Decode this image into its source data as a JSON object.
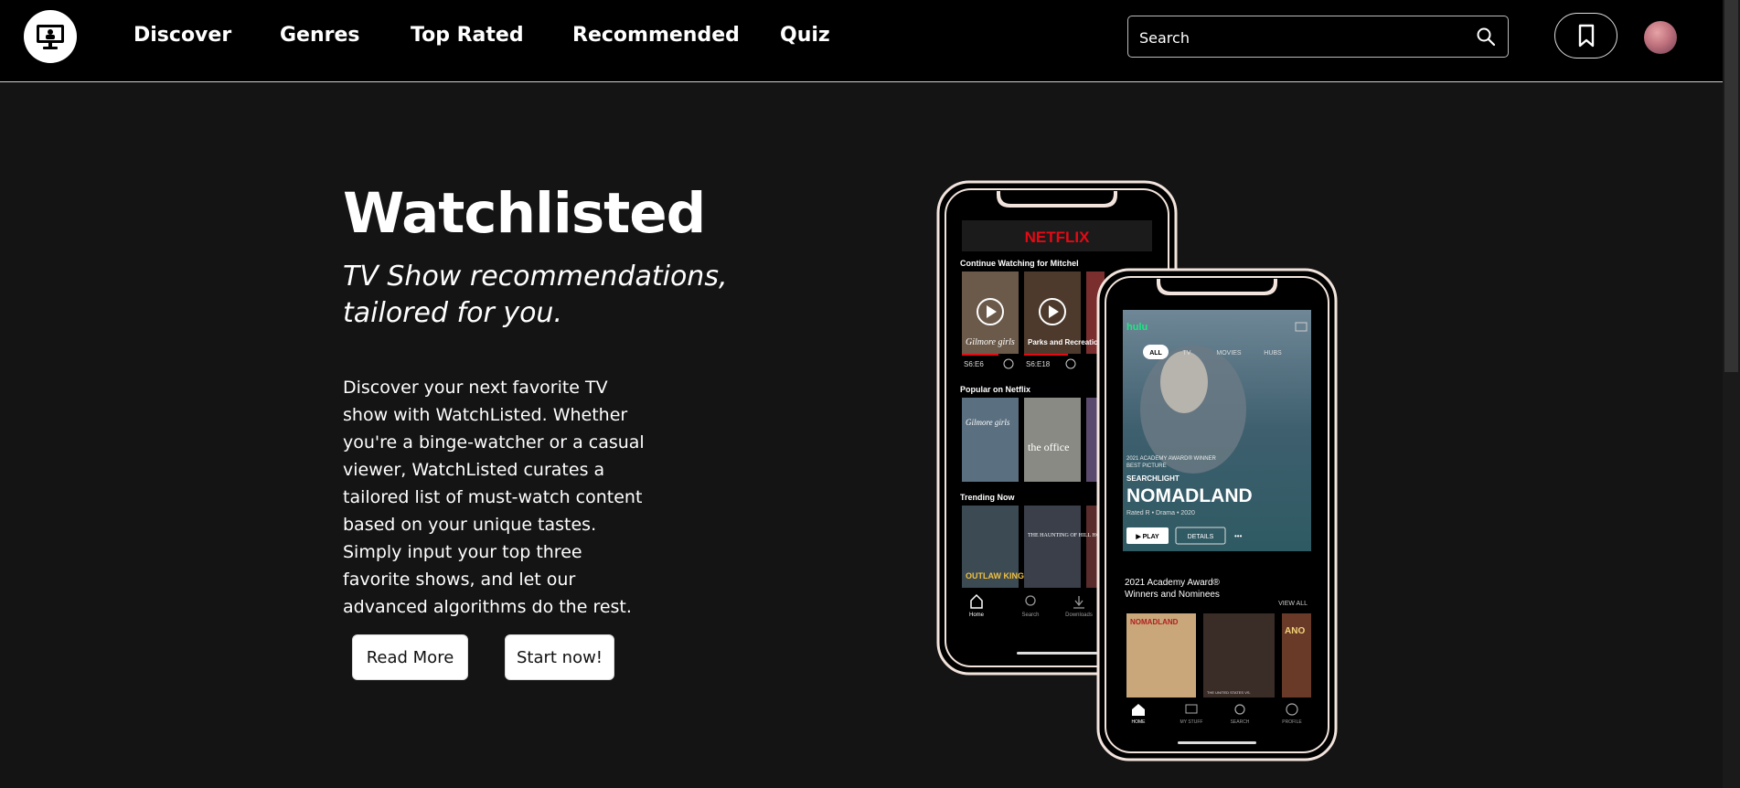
{
  "nav": {
    "links": [
      "Discover",
      "Genres",
      "Top Rated",
      "Recommended",
      "Quiz"
    ],
    "search_placeholder": "Search",
    "icons": {
      "logo": "tv-monitor-icon",
      "search": "search-icon",
      "bookmark": "bookmark-icon",
      "avatar": "user-avatar"
    }
  },
  "hero": {
    "title": "Watchlisted",
    "tagline": "TV Show recommendations, tailored for you.",
    "description": "Discover your next favorite TV show with WatchListed. Whether you're a binge-watcher or a casual viewer, WatchListed curates a tailored list of must-watch content based on your unique tastes. Simply input your top three favorite shows, and let our advanced algorithms do the rest.",
    "buttons": [
      "Read More",
      "Start now!"
    ]
  },
  "phone_netflix": {
    "brand": "NETFLIX",
    "continue_heading": "Continue Watching for Mitchel",
    "continue_items": [
      "Gilmore girls",
      "Parks and Recreation"
    ],
    "episodes": [
      "S6:E6",
      "S6:E18"
    ],
    "popular_heading": "Popular on Netflix",
    "popular_items": [
      "Gilmore girls",
      "the office"
    ],
    "trending_heading": "Trending Now",
    "trending_items": [
      "OUTLAW KING",
      "THE HAUNTING OF HILL HOUSE"
    ],
    "tabbar": [
      "Home",
      "Search",
      "Downloads"
    ]
  },
  "phone_hulu": {
    "brand": "hulu",
    "tabs": [
      "ALL",
      "TV",
      "MOVIES",
      "HUBS"
    ],
    "award_line1": "2021 ACADEMY AWARD® WINNER",
    "award_line2": "BEST PICTURE",
    "studio": "SEARCHLIGHT",
    "feature_title": "NOMADLAND",
    "feature_meta": "Rated R • Drama • 2020",
    "play_label": "▶ PLAY",
    "details_label": "DETAILS",
    "more_label": "•••",
    "row_heading": "2021 Academy Award® Winners and Nominees",
    "view_all": "VIEW ALL",
    "row_items": [
      "NOMADLAND",
      "THE UNITED STATES VS.",
      "ANO"
    ],
    "tabbar": [
      "HOME",
      "MY STUFF",
      "SEARCH",
      "PROFILE"
    ]
  }
}
